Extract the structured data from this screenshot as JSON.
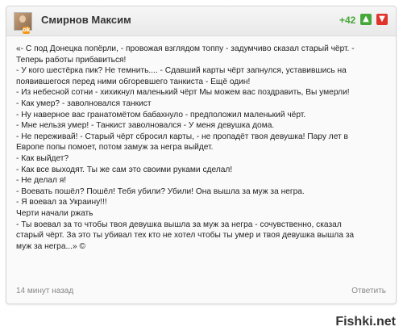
{
  "comment": {
    "author": "Смирнов Максим",
    "score": "+42",
    "vote_up": "▲",
    "vote_down": "▼",
    "avatar_badge": "ok",
    "lines": [
      "«- С под Донецка попёрли, - провожая взглядом топпу - задумчиво сказал старый чёрт. -",
      "Теперь работы прибавиться!",
      "- У кого шестёрка пик? Не темнить.... - Сдавший карты чёрт запнулся, уставившись на",
      "появившегося перед ними обгоревшего танкиста - Ещё один!",
      "- Из небесной сотни - хихикнул маленький чёрт Мы можем вас поздравить, Вы умерли!",
      "- Как умер? - заволновался танкист",
      "- Ну наверное вас гранатомётом бабахнуло - предположил маленький чёрт.",
      "- Мне нельзя умер! - Танкист заволновался - У меня девушка дома.",
      "- Не переживай! - Старый чёрт сбросил карты, - не пропадёт твоя девушка! Пару лет в",
      "Европе попы помоет, потом замуж за негра выйдет.",
      "- Как выйдет?",
      "- Как все выходят. Ты же сам это своими руками сделал!",
      "- Не делал я!",
      "- Воевать пошёл? Пошёл! Тебя убили? Убили! Она вышла за муж за негра.",
      "- Я воевал за Украину!!!",
      "Черти начали ржать",
      "- Ты воевал за то чтобы твоя девушка вышла за муж за негра - сочувственно, сказал",
      "старый чёрт. За это ты убивал тех кто не хотел чтобы ты умер и твоя девушка вышла за",
      "муж за негра...» ©"
    ],
    "time_ago": "14 минут назад",
    "reply_label": "Ответить"
  },
  "watermark": "Fishki.net"
}
